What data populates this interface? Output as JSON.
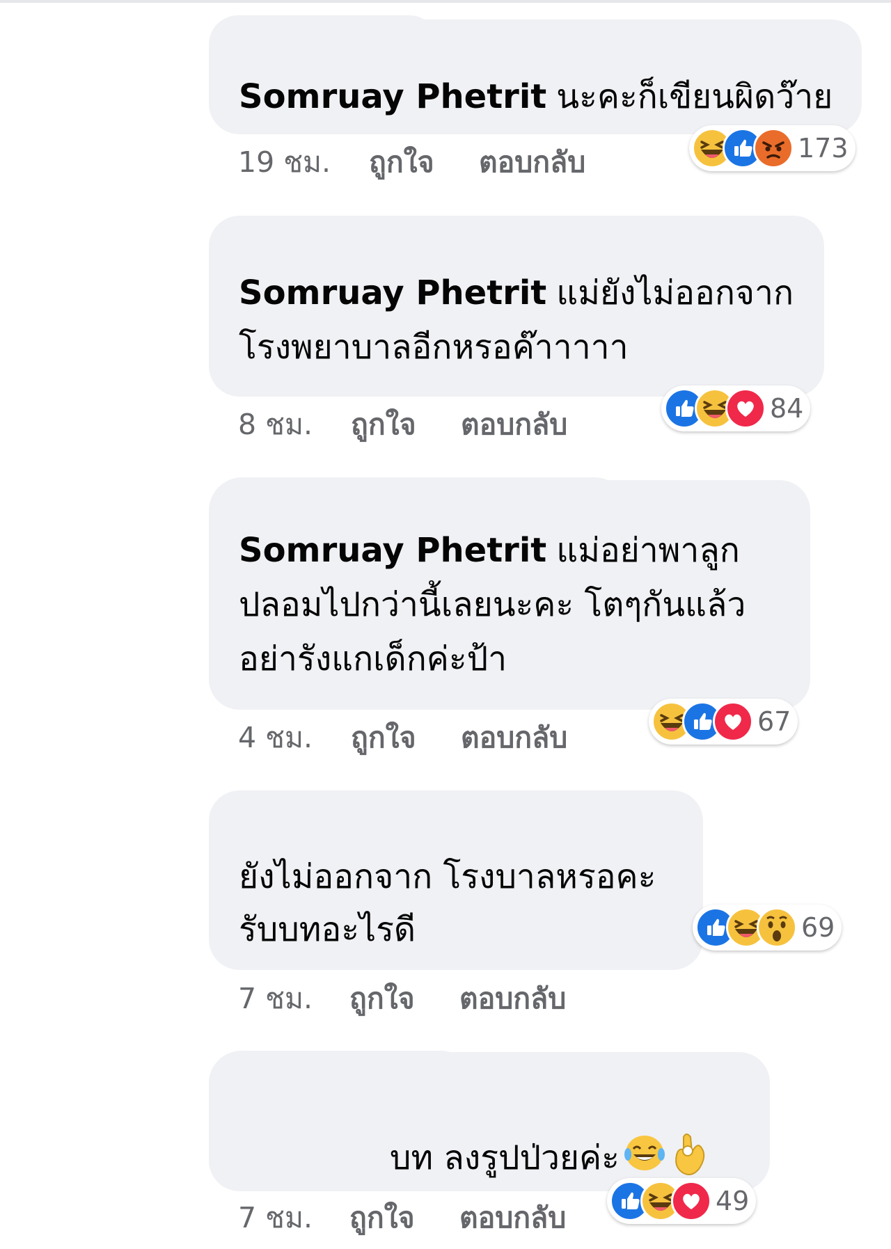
{
  "comments": [
    {
      "author": "Somruay Phetrit",
      "text_lines": [
        "นะคะก็เขียนผิดว๊าย"
      ],
      "time": "19 ชม.",
      "like_label": "ถูกใจ",
      "reply_label": "ตอบกลับ",
      "reactions": [
        "haha-icon",
        "like-icon",
        "angry-icon"
      ],
      "reaction_count": "173"
    },
    {
      "author": "Somruay Phetrit",
      "text_lines": [
        "แม่ยังไม่ออกจาก",
        "โรงพยาบาลอีกหรอค๊าาาาา"
      ],
      "time": "8 ชม.",
      "like_label": "ถูกใจ",
      "reply_label": "ตอบกลับ",
      "reactions": [
        "like-icon",
        "haha-icon",
        "love-icon"
      ],
      "reaction_count": "84"
    },
    {
      "author": "Somruay Phetrit",
      "text_lines": [
        "แม่อย่าพาลูก",
        "ปลอมไปกว่านี้เลยนะคะ โตๆกันแล้ว",
        "อย่ารังแกเด็กค่ะป้า"
      ],
      "time": "4 ชม.",
      "like_label": "ถูกใจ",
      "reply_label": "ตอบกลับ",
      "reactions": [
        "haha-icon",
        "like-icon",
        "love-icon"
      ],
      "reaction_count": "67"
    },
    {
      "author": "",
      "text_lines": [
        "ยังไม่ออกจาก โรงบาลหรอคะ",
        " รับบทอะไรดี"
      ],
      "time": "7 ชม.",
      "like_label": "ถูกใจ",
      "reply_label": "ตอบกลับ",
      "reactions": [
        "like-icon",
        "haha-icon",
        "wow-icon"
      ],
      "reaction_count": "69"
    },
    {
      "author": "",
      "text_lines": [
        "บท ลงรูปป่วยค่ะ"
      ],
      "inline_emojis": [
        "tears-of-joy-icon",
        "ok-hand-icon"
      ],
      "time": "7 ชม.",
      "like_label": "ถูกใจ",
      "reply_label": "ตอบกลับ",
      "reactions": [
        "like-icon",
        "haha-icon",
        "love-icon"
      ],
      "reaction_count": "49"
    }
  ],
  "colors": {
    "bubble": "#f0f1f4",
    "meta_text": "#65676b",
    "like": "#1b74e4",
    "love": "#f0284a",
    "haha": "#f6c23e",
    "angry": "#ea6c2a"
  }
}
